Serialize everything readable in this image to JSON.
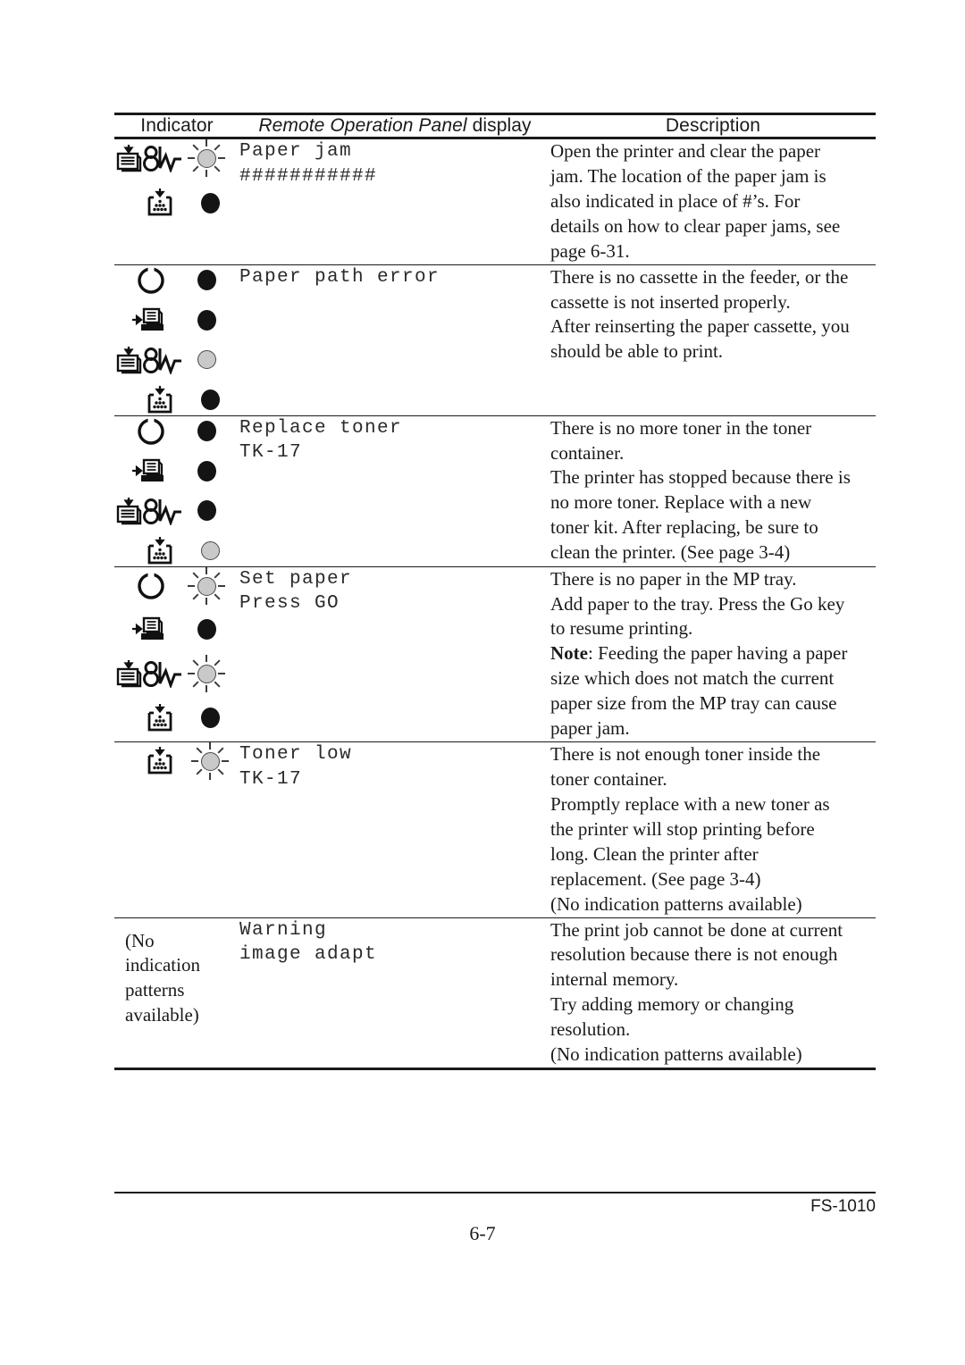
{
  "document": {
    "model": "FS-1010",
    "page_number": "6-7"
  },
  "table": {
    "headers": {
      "indicator": "Indicator",
      "display_italic": "Remote Operation Panel",
      "display_plain": " display",
      "description": "Description"
    },
    "rows": [
      {
        "id": "paper-jam",
        "indicators": [
          {
            "icons": [
              "paper-icon",
              "attention-icon"
            ],
            "lamp": "blink"
          },
          {
            "icons": [
              "toner-icon"
            ],
            "lamp": "on"
          }
        ],
        "display_lines": [
          "Paper jam",
          "###########"
        ],
        "description_lines": [
          "Open the printer and clear the paper",
          "jam. The location of the paper jam is",
          "also indicated in place of #’s. For",
          "details on how to clear paper jams, see",
          "page 6-31."
        ]
      },
      {
        "id": "paper-path-error",
        "indicators": [
          {
            "icons": [
              "power-ring-icon"
            ],
            "lamp": "on"
          },
          {
            "icons": [
              "paper-feed-icon"
            ],
            "lamp": "on"
          },
          {
            "icons": [
              "paper-icon",
              "attention-icon"
            ],
            "lamp": "off"
          },
          {
            "icons": [
              "toner-icon"
            ],
            "lamp": "on"
          }
        ],
        "display_lines": [
          "Paper path error"
        ],
        "description_lines": [
          "There is no cassette in the feeder, or the",
          "cassette is not inserted properly.",
          "After reinserting the paper cassette, you",
          "should be able to print."
        ]
      },
      {
        "id": "replace-toner",
        "indicators": [
          {
            "icons": [
              "power-ring-icon"
            ],
            "lamp": "on"
          },
          {
            "icons": [
              "paper-feed-icon"
            ],
            "lamp": "on"
          },
          {
            "icons": [
              "paper-icon",
              "attention-icon"
            ],
            "lamp": "on"
          },
          {
            "icons": [
              "toner-icon"
            ],
            "lamp": "off"
          }
        ],
        "display_lines": [
          "Replace toner",
          "TK-17"
        ],
        "description_lines": [
          "There is no more toner in the toner",
          "container.",
          "The printer has stopped because there is",
          "no more toner. Replace with a new",
          "toner kit. After replacing, be sure to",
          "clean the printer. (See page 3-4)"
        ]
      },
      {
        "id": "set-paper",
        "indicators": [
          {
            "icons": [
              "power-ring-icon"
            ],
            "lamp": "blink"
          },
          {
            "icons": [
              "paper-feed-icon"
            ],
            "lamp": "on"
          },
          {
            "icons": [
              "paper-icon",
              "attention-icon"
            ],
            "lamp": "blink"
          },
          {
            "icons": [
              "toner-icon"
            ],
            "lamp": "on"
          }
        ],
        "display_lines": [
          "Set paper",
          "Press GO"
        ],
        "description_lines": [
          "There is no paper in the MP tray.",
          "Add paper to the tray. Press the Go key",
          "to resume printing."
        ],
        "note_label": "Note",
        "note_lines": [
          ": Feeding the paper having a paper",
          "size which does not match the current",
          "paper size from the MP tray can cause",
          "paper jam."
        ]
      },
      {
        "id": "toner-low",
        "indicators": [
          {
            "icons": [
              "toner-icon"
            ],
            "lamp": "blink"
          }
        ],
        "display_lines": [
          "Toner low",
          "TK-17"
        ],
        "description_lines": [
          "There is not enough toner inside the",
          "toner container.",
          "Promptly replace with a new toner as",
          "the printer will stop printing before",
          "long. Clean the printer after",
          "replacement. (See page 3-4)",
          "(No indication patterns available)"
        ]
      },
      {
        "id": "warning-image-adapt",
        "indicator_text_lines": [
          "(No",
          "indication",
          "patterns",
          "available)"
        ],
        "display_lines": [
          "Warning",
          "image adapt"
        ],
        "description_lines": [
          "The print job cannot be done at current",
          "resolution because there is not enough",
          "internal memory.",
          "Try adding memory or changing",
          "resolution.",
          "(No indication patterns available)"
        ]
      }
    ]
  },
  "colors": {
    "ink": "#1a1a1a",
    "lamp_on": "#141414",
    "lamp_off": "#c9c9c9"
  }
}
